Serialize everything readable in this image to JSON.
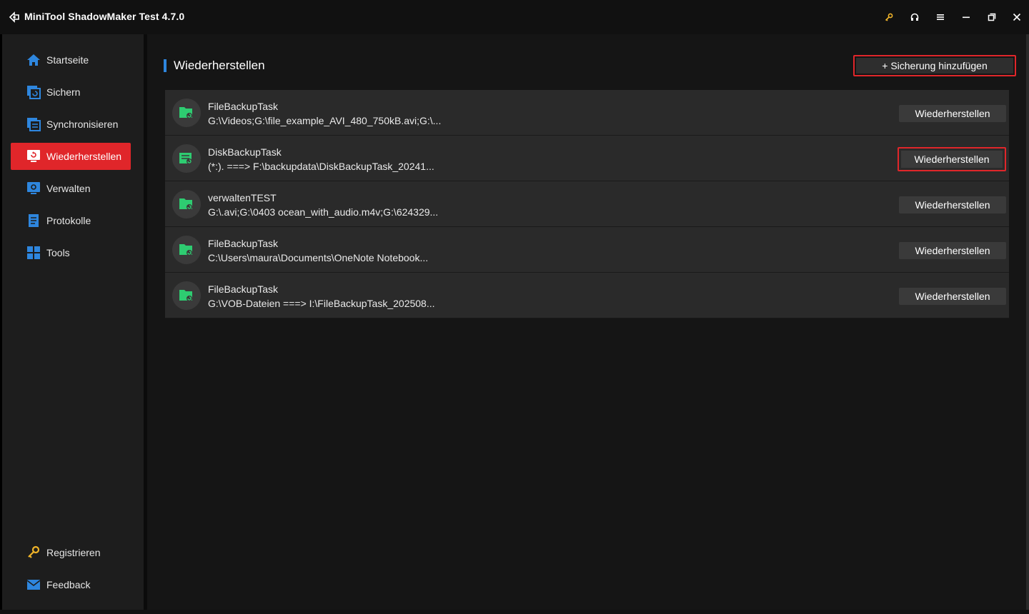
{
  "titlebar": {
    "app_title": "MiniTool ShadowMaker Test 4.7.0",
    "controls": [
      "key-icon",
      "headset-icon",
      "menu-icon",
      "minimize-icon",
      "restore-icon",
      "close-icon"
    ]
  },
  "sidebar": {
    "items": [
      {
        "label": "Startseite",
        "icon": "home-icon",
        "active": false
      },
      {
        "label": "Sichern",
        "icon": "backup-icon",
        "active": false
      },
      {
        "label": "Synchronisieren",
        "icon": "sync-icon",
        "active": false
      },
      {
        "label": "Wiederherstellen",
        "icon": "restore-icon",
        "active": true
      },
      {
        "label": "Verwalten",
        "icon": "manage-icon",
        "active": false
      },
      {
        "label": "Protokolle",
        "icon": "logs-icon",
        "active": false
      },
      {
        "label": "Tools",
        "icon": "tools-icon",
        "active": false
      }
    ],
    "bottom_items": [
      {
        "label": "Registrieren",
        "icon": "key-icon"
      },
      {
        "label": "Feedback",
        "icon": "mail-icon"
      }
    ]
  },
  "main": {
    "title": "Wiederherstellen",
    "add_button": "+ Sicherung hinzufügen",
    "tasks": [
      {
        "name": "FileBackupTask",
        "path": "G:\\Videos;G:\\file_example_AVI_480_750kB.avi;G:\\...",
        "button": "Wiederherstellen"
      },
      {
        "name": "DiskBackupTask",
        "path": "(*:). ===> F:\\backupdata\\DiskBackupTask_20241...",
        "button": "Wiederherstellen"
      },
      {
        "name": "verwaltenTEST",
        "path": "G:\\.avi;G:\\0403 ocean_with_audio.m4v;G:\\624329...",
        "button": "Wiederherstellen"
      },
      {
        "name": "FileBackupTask",
        "path": "C:\\Users\\maura\\Documents\\OneNote Notebook...",
        "button": "Wiederherstellen"
      },
      {
        "name": "FileBackupTask",
        "path": "G:\\VOB-Dateien ===> I:\\FileBackupTask_202508...",
        "button": "Wiederherstellen"
      }
    ]
  },
  "colors": {
    "accent_red": "#e0262a",
    "accent_blue": "#2e86de",
    "icon_green": "#2ecc71",
    "key_yellow": "#f0b429"
  }
}
